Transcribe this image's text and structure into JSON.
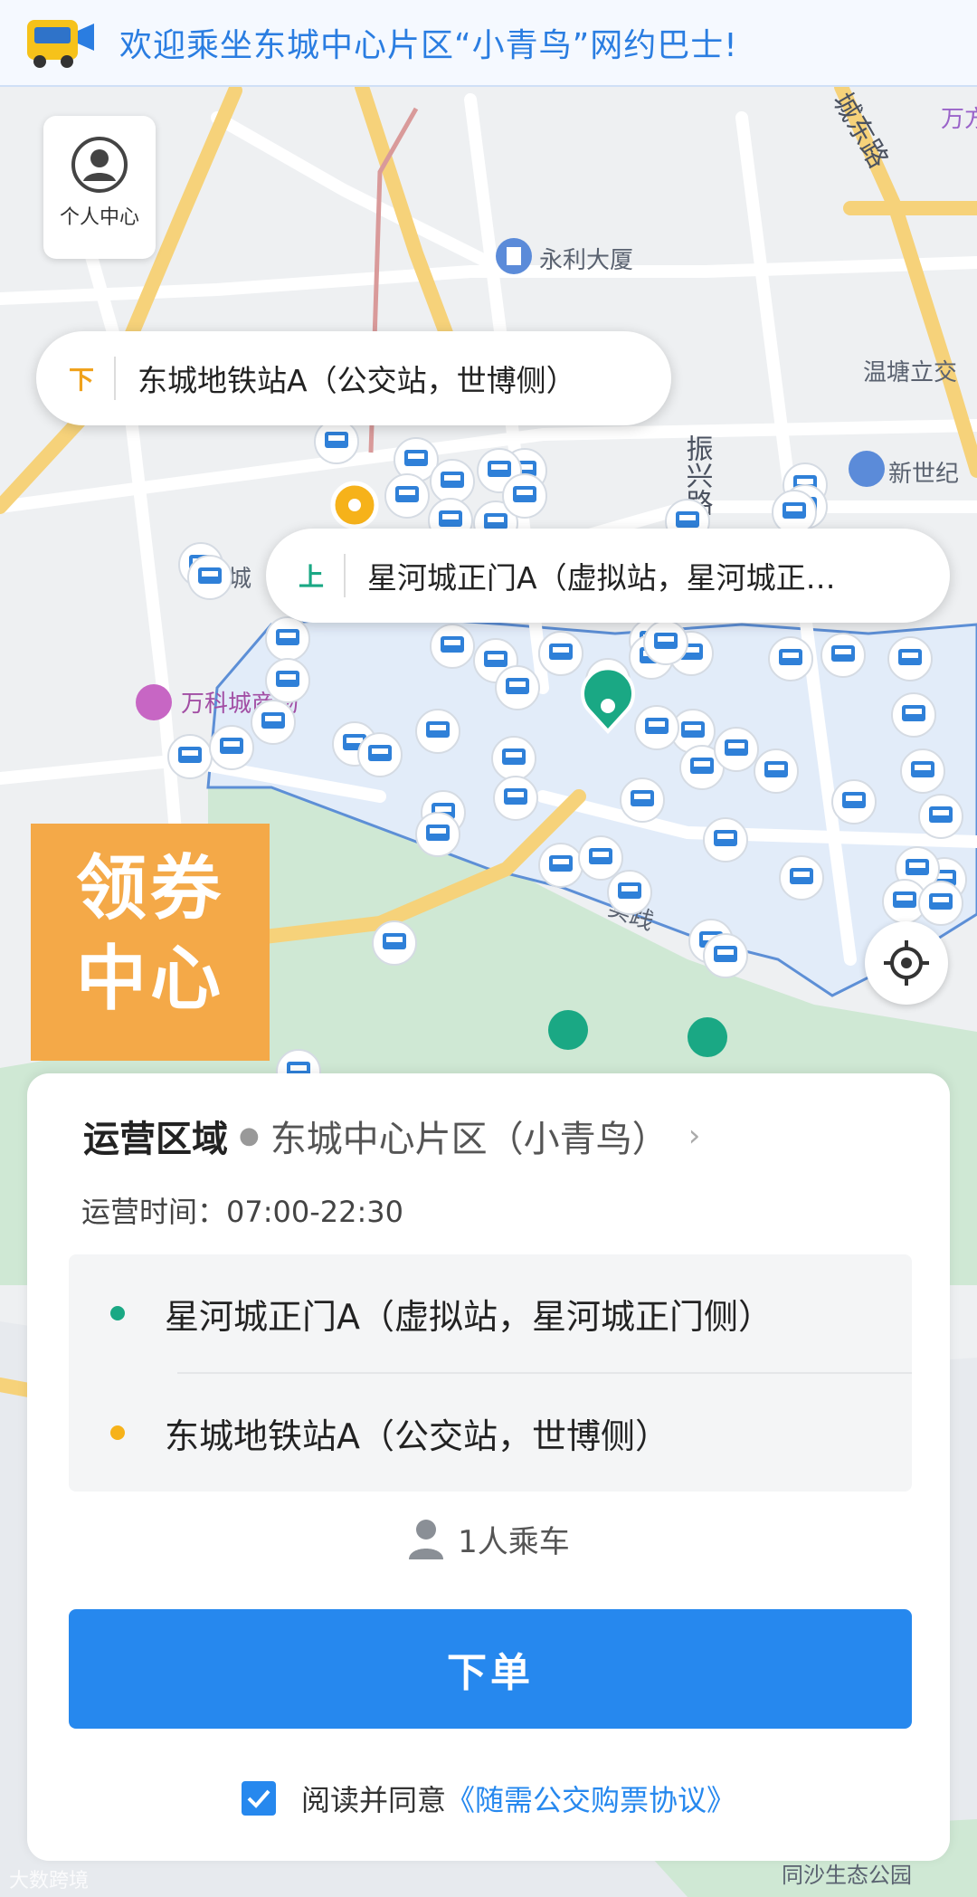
{
  "banner": {
    "text": "欢迎乘坐东城中心片区“小青鸟”网约巴士!"
  },
  "profile": {
    "label": "个人中心"
  },
  "map": {
    "labels": {
      "chengdong_road": "城东路",
      "wanfang": "万方",
      "yongli": "永利大厦",
      "wentang": "温塘立交",
      "zhenxing_road": "振兴路",
      "xinshiji": "新世纪",
      "dongcheng": "东城",
      "wanke": "万科城商场",
      "shiji": "实践",
      "park": "同沙生态公园"
    },
    "colors": {
      "green_stop": "#1aa884",
      "orange_stop": "#f6b21a",
      "area_fill": "#e2ecf9",
      "area_border": "#5d8fd6"
    }
  },
  "dropoff_bubble": {
    "badge": "下",
    "name": "东城地铁站A（公交站，世博侧）",
    "badge_color": "#f0a21c"
  },
  "pickup_bubble": {
    "badge": "上",
    "name": "星河城正门A（虚拟站，星河城正…",
    "badge_color": "#1aa884"
  },
  "coupon": {
    "line1": "领券",
    "line2": "中心"
  },
  "panel": {
    "area_label": "运营区域",
    "area_value": "东城中心片区（小青鸟）",
    "hours": "运营时间：07:00-22:30",
    "pickup": "星河城正门A（虚拟站，星河城正门侧）",
    "dropoff": "东城地铁站A（公交站，世博侧）",
    "passengers": "1人乘车",
    "order_button": "下单",
    "agree_text": "阅读并同意",
    "agree_link": "《随需公交购票协议》"
  },
  "watermark": "大数跨境"
}
